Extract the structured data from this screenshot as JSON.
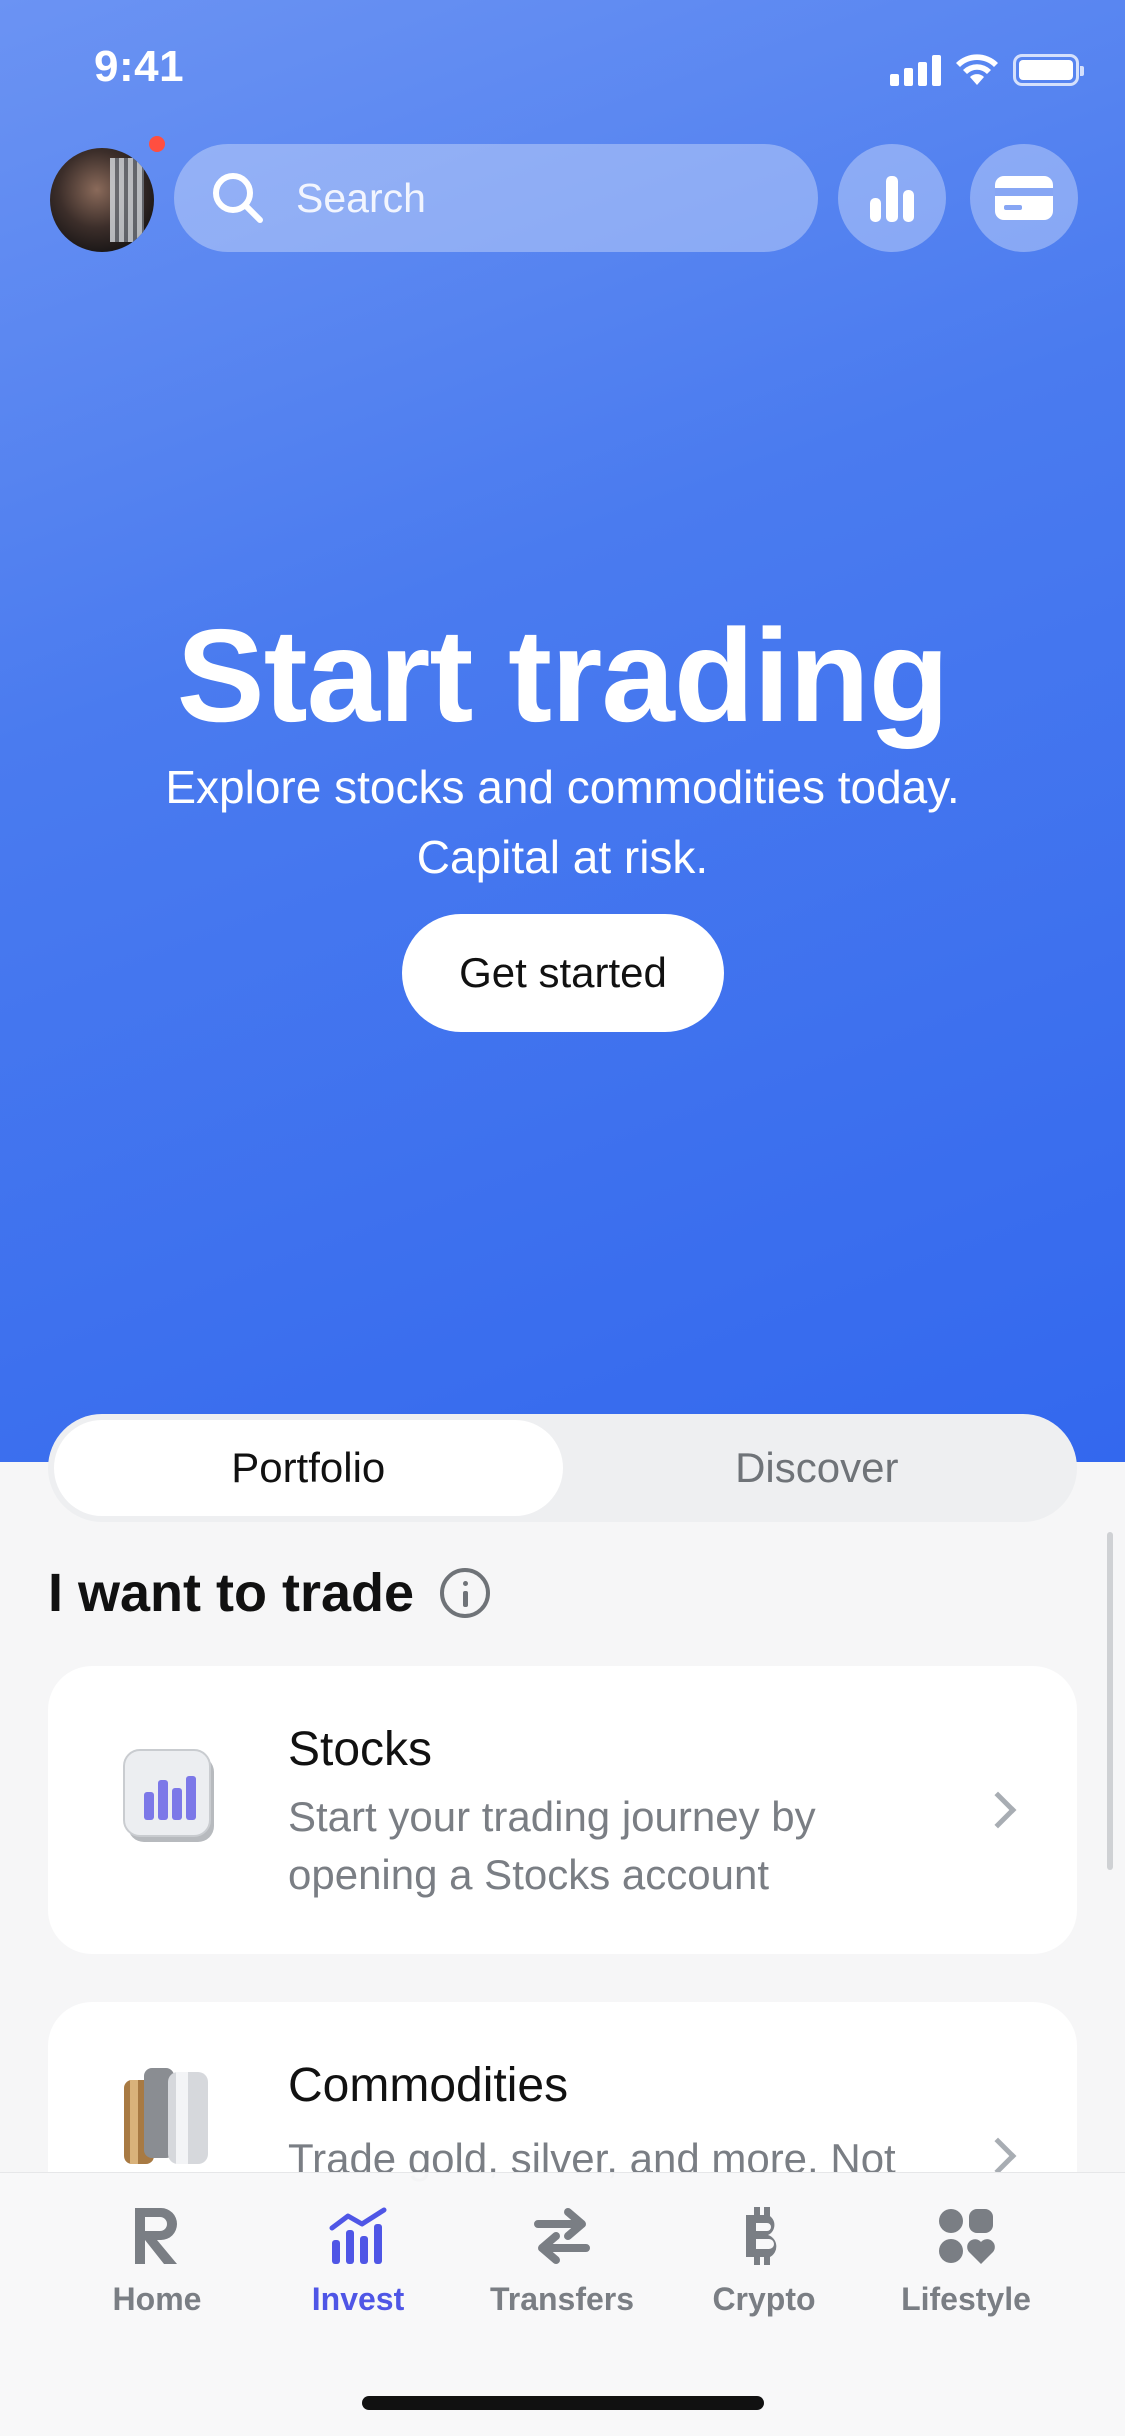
{
  "status_bar": {
    "time": "9:41"
  },
  "header": {
    "search_placeholder": "Search",
    "icons": [
      "avatar",
      "search-icon",
      "bar-chart-icon",
      "card-icon"
    ]
  },
  "hero": {
    "title": "Start trading",
    "subtitle_line1": "Explore stocks and commodities today.",
    "subtitle_line2": "Capital at risk.",
    "cta_label": "Get started"
  },
  "segmented": {
    "tabs": [
      {
        "label": "Portfolio",
        "active": true
      },
      {
        "label": "Discover",
        "active": false
      }
    ]
  },
  "section": {
    "title": "I want to trade"
  },
  "cards": [
    {
      "title": "Stocks",
      "desc_line1": "Start your trading journey by",
      "desc_line2": "opening a Stocks account"
    },
    {
      "title": "Commodities",
      "desc_line1": "Trade gold, silver, and more. Not",
      "desc_line2": ""
    }
  ],
  "tabbar": {
    "items": [
      {
        "label": "Home",
        "icon": "revolut-r-icon"
      },
      {
        "label": "Invest",
        "icon": "invest-chart-icon",
        "active": true
      },
      {
        "label": "Transfers",
        "icon": "transfer-arrows-icon"
      },
      {
        "label": "Crypto",
        "icon": "bitcoin-icon"
      },
      {
        "label": "Lifestyle",
        "icon": "lifestyle-icon"
      }
    ]
  },
  "colors": {
    "hero_gradient_top": "#6b93f3",
    "hero_gradient_bottom": "#3368ee",
    "active_tab": "#4f56e6",
    "notification_dot": "#ff4f40"
  }
}
